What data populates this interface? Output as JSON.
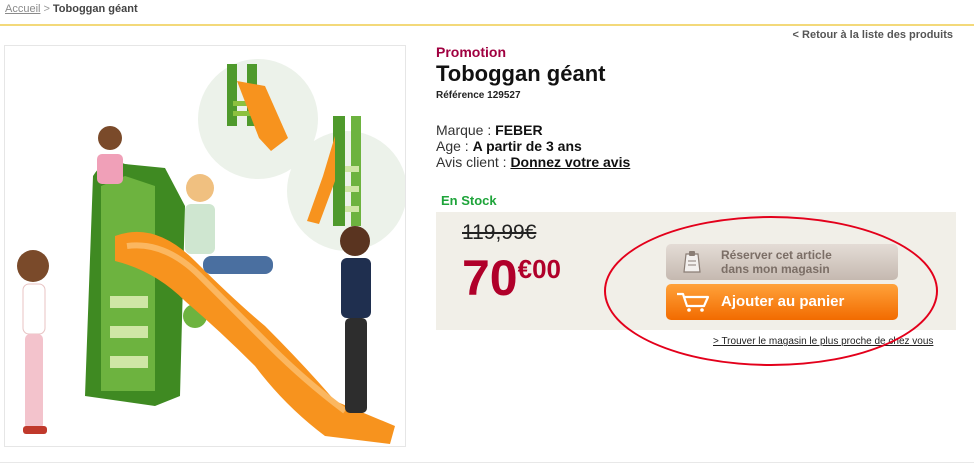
{
  "breadcrumb": {
    "home": "Accueil",
    "separator": ">",
    "current": "Toboggan géant"
  },
  "back_link": "< Retour à la liste des produits",
  "product": {
    "promo_label": "Promotion",
    "title": "Toboggan géant",
    "reference": "Référence 129527",
    "brand_label": "Marque :",
    "brand_value": "FEBER",
    "age_label": "Age :",
    "age_value": "A partir de 3 ans",
    "review_label": "Avis client :",
    "review_link": "Donnez votre avis"
  },
  "buy": {
    "stock": "En Stock",
    "old_price": "119,99€",
    "price_int": "70",
    "price_cents": "€00",
    "reserve_line1": "Réserver cet article",
    "reserve_line2": "dans mon magasin",
    "add_to_cart": "Ajouter au panier",
    "store_link": "> Trouver le magasin le plus proche de chez vous"
  },
  "colors": {
    "promo": "#a00040",
    "price": "#b0002a",
    "stock": "#1ea43a",
    "cart_button": "#f57a0f",
    "annotation": "#e3001b"
  }
}
